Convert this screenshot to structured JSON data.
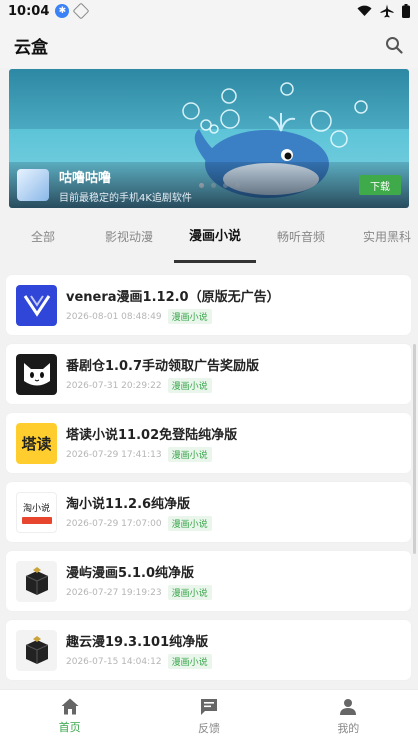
{
  "status_bar": {
    "time": "10:04"
  },
  "app": {
    "title": "云盒"
  },
  "banner": {
    "title": "咕噜咕噜",
    "subtitle": "目前最稳定的手机4K追剧软件",
    "button": "下载",
    "page_count": 4,
    "active_page": 1
  },
  "tabs": [
    {
      "label": "全部",
      "active": false
    },
    {
      "label": "影视动漫",
      "active": false
    },
    {
      "label": "漫画小说",
      "active": true
    },
    {
      "label": "畅听音频",
      "active": false
    },
    {
      "label": "实用黑科",
      "active": false
    }
  ],
  "apps": [
    {
      "name": "venera漫画1.12.0（原版无广告）",
      "date": "2026-08-01 08:48:49",
      "tag": "漫画小说",
      "icon": "venera-logo-icon"
    },
    {
      "name": "番剧仓1.0.7手动领取广告奖励版",
      "date": "2026-07-31 20:29:22",
      "tag": "漫画小说",
      "icon": "cat-logo-icon"
    },
    {
      "name": "塔读小说11.02免登陆纯净版",
      "date": "2026-07-29 17:41:13",
      "tag": "漫画小说",
      "icon": "tadu-logo-icon",
      "icon_text": "塔读"
    },
    {
      "name": "淘小说11.2.6纯净版",
      "date": "2026-07-29 17:07:00",
      "tag": "漫画小说",
      "icon": "taoxiaoshuo-logo-icon",
      "icon_text": "淘小说"
    },
    {
      "name": "漫屿漫画5.1.0纯净版",
      "date": "2026-07-27 19:19:23",
      "tag": "漫画小说",
      "icon": "box-logo-icon"
    },
    {
      "name": "趣云漫19.3.101纯净版",
      "date": "2026-07-15 14:04:12",
      "tag": "漫画小说",
      "icon": "box-logo-icon"
    }
  ],
  "bottom_nav": [
    {
      "label": "首页",
      "icon": "home-icon",
      "active": true
    },
    {
      "label": "反馈",
      "icon": "feedback-icon",
      "active": false
    },
    {
      "label": "我的",
      "icon": "person-icon",
      "active": false
    }
  ],
  "colors": {
    "accent": "#3aa64b",
    "tag_bg": "#eaf6ec"
  }
}
